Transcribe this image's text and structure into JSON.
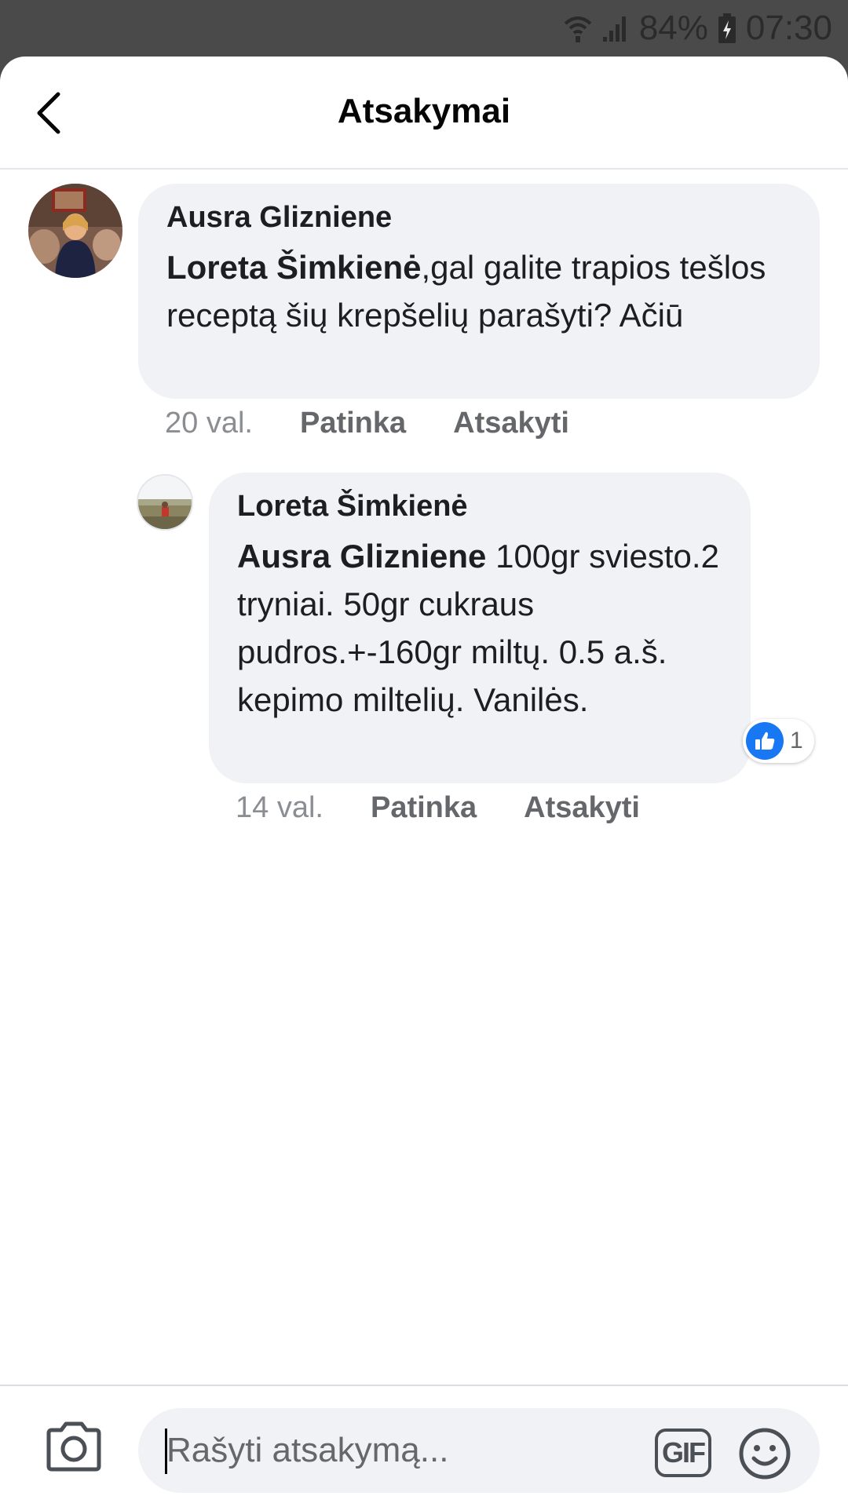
{
  "status_bar": {
    "battery": "84%",
    "time": "07:30",
    "icons": [
      "wifi-icon",
      "signal-icon",
      "battery-charging-icon"
    ]
  },
  "header": {
    "back_icon": "chevron-left-icon",
    "title": "Atsakymai"
  },
  "comments": [
    {
      "author": "Ausra Glizniene",
      "mention": "Loreta Šimkienė",
      "text": ",gal galite trapios tešlos receptą šių krepšelių parašyti? Ačiū",
      "time": "20 val.",
      "like_label": "Patinka",
      "reply_label": "Atsakyti"
    },
    {
      "author": "Loreta Šimkienė",
      "mention": "Ausra Glizniene",
      "text": " 100gr sviesto.2 tryniai. 50gr cukraus pudros.+-160gr miltų. 0.5 a.š. kepimo miltelių. Vanilės.",
      "time": "14 val.",
      "like_label": "Patinka",
      "reply_label": "Atsakyti",
      "reaction_count": "1",
      "reaction_icon": "thumbs-up-icon"
    }
  ],
  "composer": {
    "placeholder": "Rašyti atsakymą...",
    "camera_icon": "camera-icon",
    "gif_label": "GIF",
    "emoji_icon": "smiley-icon"
  },
  "colors": {
    "status_bar_bg": "#4a4a4a",
    "bubble_bg": "#f0f2f5",
    "like_blue": "#1877f2",
    "meta_grey": "#65676b"
  }
}
